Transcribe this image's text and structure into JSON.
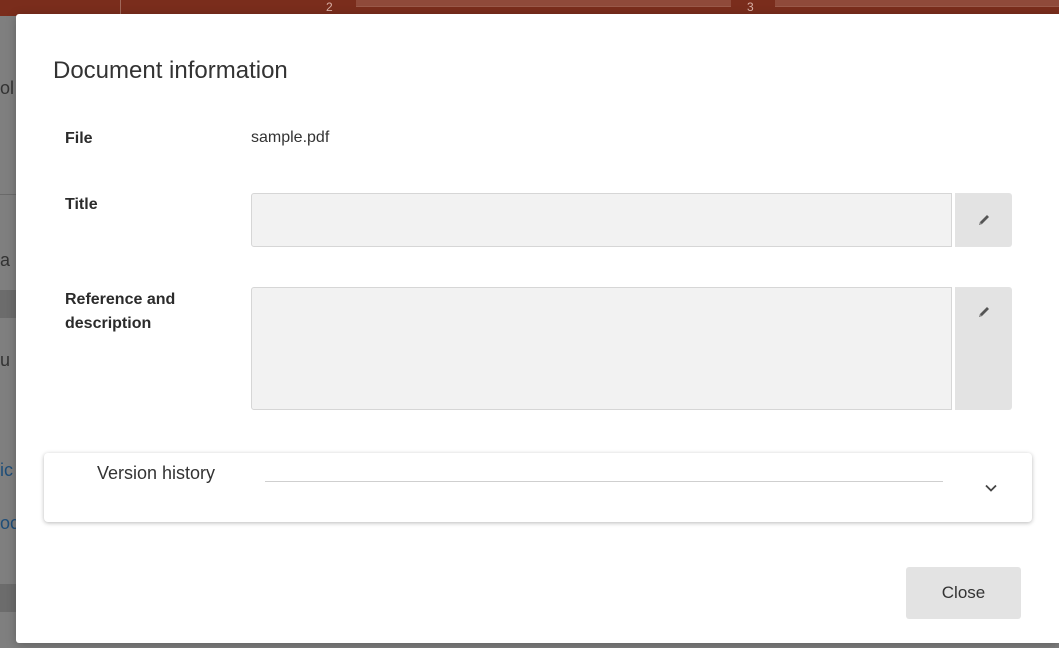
{
  "background": {
    "steps": [
      "2",
      "3"
    ],
    "text_fragments": [
      "ol",
      "a",
      "u",
      "ic",
      "oc"
    ]
  },
  "modal": {
    "title": "Document information",
    "fields": {
      "file": {
        "label": "File",
        "value": "sample.pdf"
      },
      "title": {
        "label": "Title",
        "value": "",
        "edit_icon": "pencil-icon"
      },
      "reference": {
        "label": "Reference and description",
        "value": "",
        "edit_icon": "pencil-icon"
      }
    },
    "version_history": {
      "label": "Version history",
      "icon": "chevron-down-icon"
    },
    "close_label": "Close"
  },
  "colors": {
    "header_bar": "#7a2d1c",
    "input_bg": "#f2f2f2",
    "button_bg": "#e3e3e3",
    "overlay": "#7f7f7f"
  }
}
